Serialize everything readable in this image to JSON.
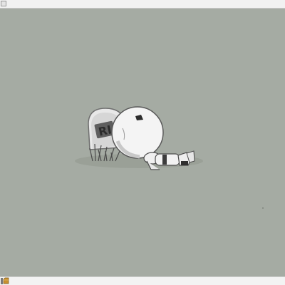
{
  "window": {
    "background": "#a4aaa2"
  },
  "wallpaper": {
    "tombstone_text": "RI",
    "icons": [
      "tombstone",
      "grass",
      "robot-head",
      "robot-body"
    ]
  },
  "taskbar": {
    "start_icon": "folder-icon",
    "start_icon_color": "#c8912f"
  }
}
